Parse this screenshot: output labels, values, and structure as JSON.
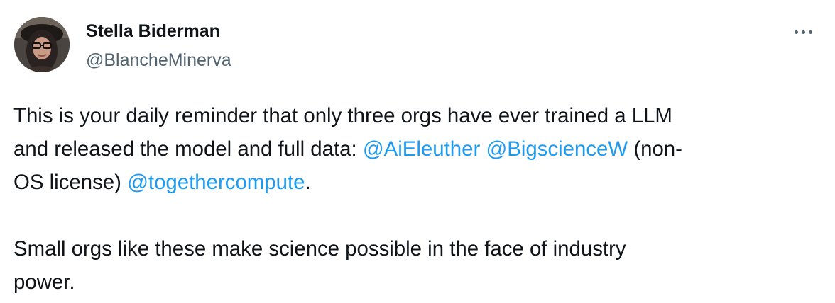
{
  "author": {
    "name": "Stella Biderman",
    "handle": "@BlancheMinerva"
  },
  "more_icon": "more-horizontal-icon",
  "colors": {
    "text": "#0f1419",
    "secondary": "#536471",
    "link": "#1d9bf0",
    "background": "#ffffff"
  },
  "tweet": {
    "line1": "This is your daily reminder that only three orgs have ever trained a LLM",
    "line2_prefix": "and released the model and full data: ",
    "mention1": "@AiEleuther",
    "line2_space": " ",
    "mention2": "@BigscienceW",
    "line2_suffix": " (non-",
    "line3_prefix": "OS license) ",
    "mention3": "@togethercompute",
    "line3_suffix": ".",
    "line4": "Small orgs like these make science possible in the face of industry",
    "line5": "power."
  }
}
